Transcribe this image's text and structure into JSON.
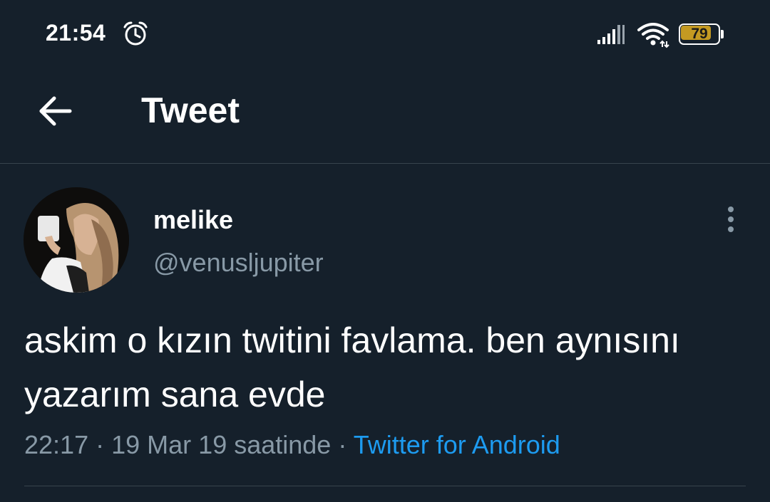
{
  "status_bar": {
    "time": "21:54",
    "battery_level": "79",
    "battery_color": "#c49a22"
  },
  "header": {
    "title": "Tweet",
    "back_icon": "arrow-left-icon"
  },
  "tweet": {
    "display_name": "melike",
    "handle": "@venusljupiter",
    "text": "askim o kızın twitini favlama. ben aynısını yazarım sana evde",
    "time": "22:17",
    "date": "19 Mar 19 saatinde",
    "separator": "·",
    "source": "Twitter for Android"
  },
  "colors": {
    "background": "#15202b",
    "secondary_text": "#8899a6",
    "link": "#1d9bf0",
    "divider": "#38444d"
  }
}
